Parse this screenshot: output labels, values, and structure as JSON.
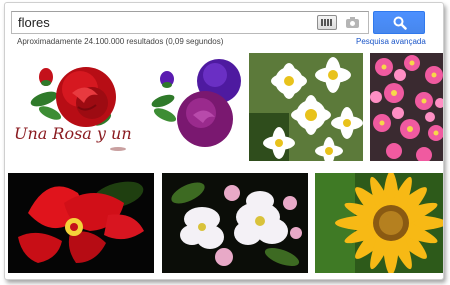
{
  "search": {
    "query": "flores"
  },
  "results": {
    "stats": "Aproximadamente 24.100.000 resultados (0,09 segundos)",
    "advanced_link": "Pesquisa avançada"
  },
  "images": [
    {
      "caption": "Una Rosa y un"
    },
    {},
    {},
    {},
    {},
    {},
    {}
  ],
  "icons": {
    "keyboard": "keyboard-icon",
    "camera": "camera-icon",
    "search": "search-icon"
  },
  "colors": {
    "search_button": "#4d90fe",
    "link": "#1a55c8"
  }
}
